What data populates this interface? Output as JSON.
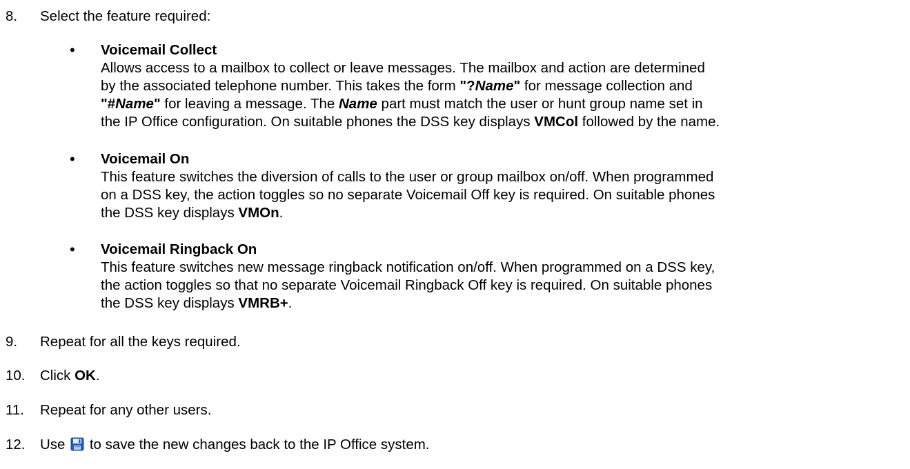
{
  "steps": {
    "s8": {
      "num": "8.",
      "text": "Select the feature required:"
    },
    "s9": {
      "num": "9.",
      "text": "Repeat for all the keys required."
    },
    "s10": {
      "num": "10.",
      "pre": "Click ",
      "bold": "OK",
      "post": "."
    },
    "s11": {
      "num": "11.",
      "text": "Repeat for any other users."
    },
    "s12": {
      "num": "12.",
      "pre": "Use ",
      "icon": "save-icon",
      "post": " to save the new changes back to the IP Office system."
    }
  },
  "features": {
    "collect": {
      "title": "Voicemail Collect",
      "l1": "Allows access to a mailbox to collect or leave messages. The mailbox and action are determined",
      "l2_pre": "by the associated telephone number. This takes the form ",
      "l2_q1": "\"?",
      "l2_name1": "Name",
      "l2_q2": "\"",
      "l2_post": " for message collection and",
      "l3_q1": "\"#",
      "l3_name1": "Name",
      "l3_q2": "\"",
      "l3_mid": " for leaving a message. The ",
      "l3_name2": "Name",
      "l3_post": " part must match the user or hunt group name set in",
      "l4_pre": "the IP Office configuration. On suitable phones the DSS key displays ",
      "l4_bold": "VMCol",
      "l4_post": " followed by the name."
    },
    "on": {
      "title": "Voicemail On",
      "l1": "This feature switches the diversion of calls to the user or group mailbox on/off. When programmed",
      "l2": "on a DSS key, the action toggles so no separate Voicemail Off key is required. On suitable phones",
      "l3_pre": "the DSS key displays ",
      "l3_bold": "VMOn",
      "l3_post": "."
    },
    "ringback": {
      "title": "Voicemail Ringback On",
      "l1": "This feature switches new message ringback notification on/off. When programmed on a DSS key,",
      "l2": "the action toggles so that no separate Voicemail Ringback Off key is required. On suitable phones",
      "l3_pre": "the DSS key displays ",
      "l3_bold": "VMRB+",
      "l3_post": "."
    }
  },
  "bullet_glyph": "•",
  "colors": {
    "text": "#000000",
    "icon_blue": "#1f5fbf",
    "icon_label": "#e8eef8"
  }
}
